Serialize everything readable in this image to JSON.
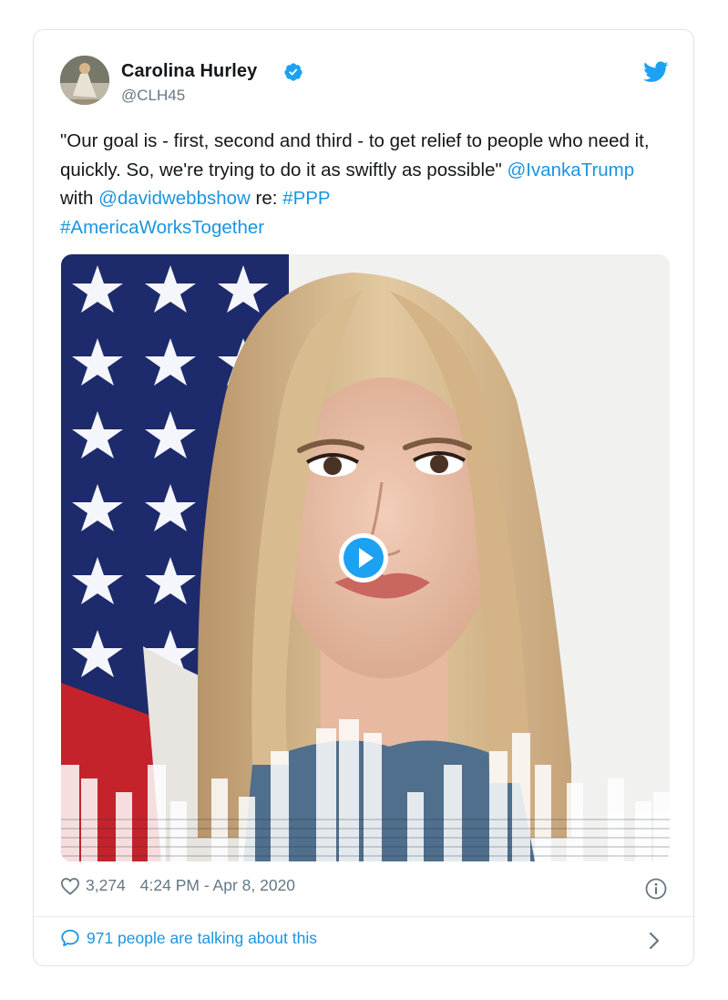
{
  "tweet": {
    "author_name": "Carolina Hurley",
    "author_handle": "@CLH45",
    "text_part1": "\"Our goal is - first, second and third - to get relief to people who need it, quickly. So, we're trying to do it as swiftly as possible\" ",
    "mention1": "@IvankaTrump",
    "text_part2": " with ",
    "mention2": "@davidwebbshow",
    "text_part3": " re: ",
    "hashtag1": "#PPP",
    "hashtag2": "#AmericaWorksTogether",
    "likes": "3,274",
    "timestamp": "4:24 PM - Apr 8, 2020",
    "talking": "971 people are talking about this"
  },
  "icons": {
    "verified": "verified-badge-icon",
    "brand": "twitter-bird-icon",
    "play": "play-icon",
    "like": "heart-icon",
    "info": "info-icon",
    "reply": "speech-bubble-icon",
    "more": "chevron-right-icon"
  },
  "colors": {
    "link": "#1b95e0",
    "muted": "#657786",
    "text": "#14171a",
    "border": "#dfe3e7"
  }
}
